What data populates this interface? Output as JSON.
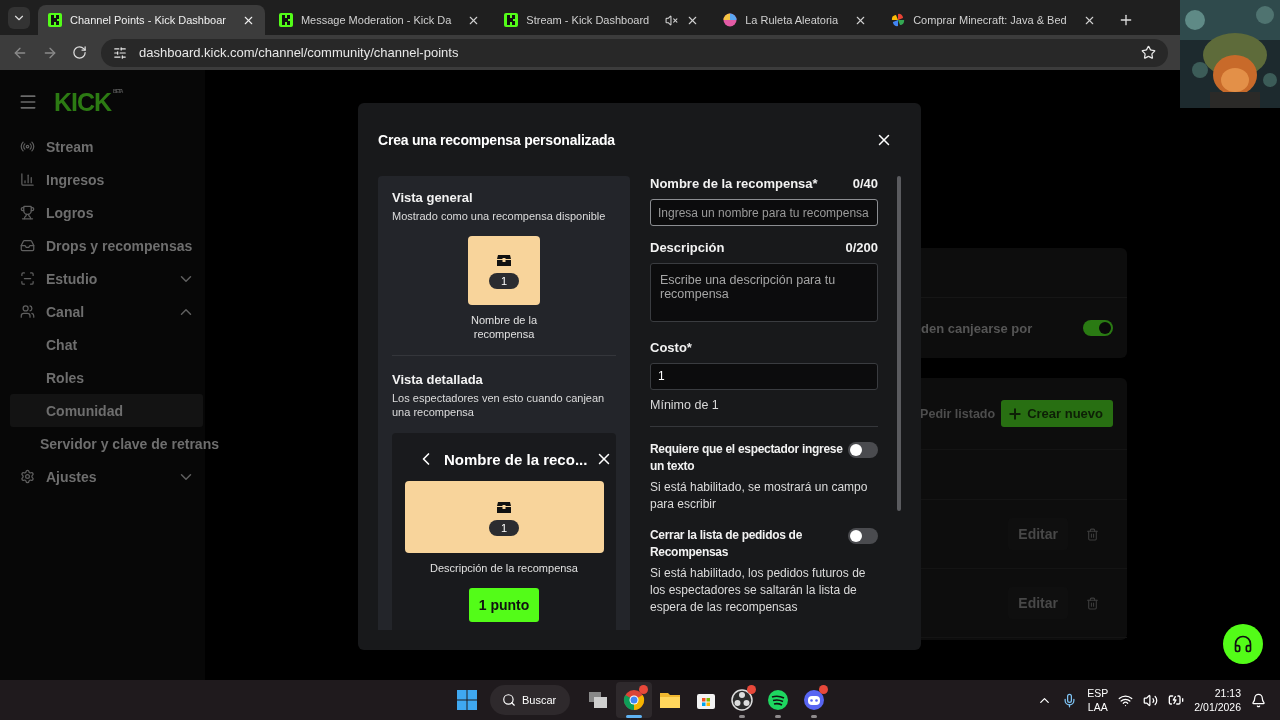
{
  "browser": {
    "tabs": [
      {
        "title": "Channel Points - Kick Dashboar",
        "kind": "kick",
        "selected": true,
        "muted": false
      },
      {
        "title": "Message Moderation - Kick Da",
        "kind": "kick",
        "selected": false,
        "muted": false
      },
      {
        "title": "Stream - Kick Dashboard",
        "kind": "kick",
        "selected": false,
        "muted": true
      },
      {
        "title": "La Ruleta Aleatoria",
        "kind": "wheel",
        "selected": false,
        "muted": false
      },
      {
        "title": "Comprar Minecraft: Java & Bed",
        "kind": "pinwheel",
        "selected": false,
        "muted": false
      }
    ],
    "address": "dashboard.kick.com/channel/community/channel-points"
  },
  "logo": {
    "text": "KICK",
    "badge": "BETA"
  },
  "sidebar": {
    "items": [
      {
        "label": "Stream",
        "kind": "stream",
        "selected": false
      },
      {
        "label": "Ingresos",
        "kind": "revenue",
        "selected": false
      },
      {
        "label": "Logros",
        "kind": "trophy",
        "selected": false
      },
      {
        "label": "Drops y recompensas",
        "kind": "drops",
        "selected": false
      },
      {
        "label": "Estudio",
        "kind": "studio",
        "selected": false,
        "expanded": false
      },
      {
        "label": "Canal",
        "kind": "channel",
        "selected": false,
        "expanded": true,
        "children": [
          {
            "label": "Chat",
            "selected": false
          },
          {
            "label": "Roles",
            "selected": false
          },
          {
            "label": "Comunidad",
            "selected": true
          }
        ]
      },
      {
        "label": "Servidor y clave de retrans",
        "selected": false
      },
      {
        "label": "Ajustes",
        "kind": "settings",
        "selected": false,
        "expanded": false
      }
    ]
  },
  "page": {
    "settings_card": {
      "text": "den canjearse por",
      "on": true
    },
    "rewards_card": {
      "request_button": "Pedir listado",
      "create_button": "Crear nuevo",
      "rows": [
        {
          "edit": "Editar"
        },
        {
          "edit": "Editar"
        }
      ]
    }
  },
  "modal": {
    "title": "Crea una recompensa personalizada",
    "preview": {
      "overview_title": "Vista general",
      "overview_desc": "Mostrado como una recompensa disponible",
      "tile_cost": "1",
      "tile_name": "Nombre de la recompensa",
      "detail_title": "Vista detallada",
      "detail_desc": "Los espectadores ven esto cuando canjean una recompensa",
      "detail_header": "Nombre de la reco...",
      "banner_cost": "1",
      "banner_desc": "Descripción de la recompensa",
      "points_button": "1 punto"
    },
    "form": {
      "name": {
        "label": "Nombre de la recompensa*",
        "counter": "0/40",
        "placeholder": "Ingresa un nombre para tu recompensa"
      },
      "description": {
        "label": "Descripción",
        "counter": "0/200",
        "placeholder": "Escribe una descripción para tu recompensa"
      },
      "cost": {
        "label": "Costo*",
        "value": "1",
        "hint": "Mínimo de 1"
      },
      "toggles": [
        {
          "title": "Requiere que el espectador ingrese un texto",
          "desc": "Si está habilitado, se mostrará un campo para escribir",
          "on": false
        },
        {
          "title": "Cerrar la lista de pedidos de Recompensas",
          "desc": "Si está habilitado, los pedidos futuros de los espectadores se saltarán la lista de espera de las recompensas",
          "on": false
        }
      ]
    }
  },
  "taskbar": {
    "search": "Buscar",
    "apps": [
      {
        "kind": "taskview",
        "running": false,
        "active": false,
        "badge": false
      },
      {
        "kind": "chrome",
        "running": true,
        "active": true,
        "badge": true
      },
      {
        "kind": "folder",
        "running": false,
        "active": false,
        "badge": false
      },
      {
        "kind": "store",
        "running": false,
        "active": false,
        "badge": false
      },
      {
        "kind": "obs",
        "running": true,
        "active": false,
        "badge": true
      },
      {
        "kind": "spotify",
        "running": true,
        "active": false,
        "badge": false
      },
      {
        "kind": "discord",
        "running": true,
        "active": false,
        "badge": true
      }
    ],
    "tray": {
      "language": "ESP",
      "layout": "LAA",
      "time": "21:13",
      "date": "2/01/2026"
    }
  }
}
